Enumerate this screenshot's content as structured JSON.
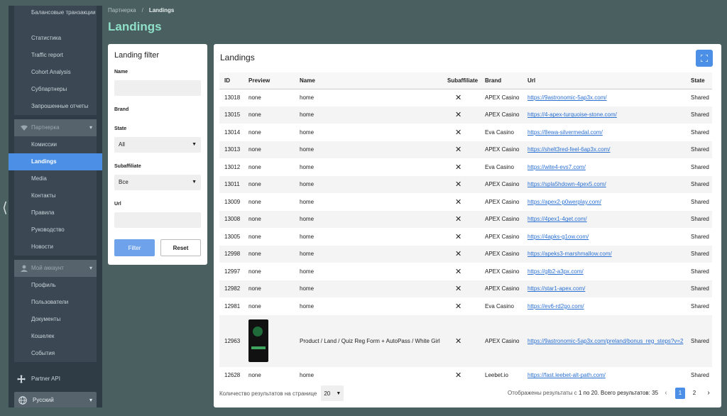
{
  "sidebar": {
    "top_items": [
      {
        "label": "Балансовые транзакции"
      },
      {
        "label": "Статистика"
      },
      {
        "label": "Traffic report"
      },
      {
        "label": "Cohort Analysis"
      },
      {
        "label": "Субпартнеры"
      },
      {
        "label": "Запрошенные отчеты"
      }
    ],
    "partner_header": "Партнерка",
    "partner_items": [
      {
        "label": "Комиссии"
      },
      {
        "label": "Landings"
      },
      {
        "label": "Media"
      },
      {
        "label": "Контакты"
      },
      {
        "label": "Правила"
      },
      {
        "label": "Руководство"
      },
      {
        "label": "Новости"
      }
    ],
    "account_header": "Мой аккаунт",
    "account_items": [
      {
        "label": "Профиль"
      },
      {
        "label": "Пользователи"
      },
      {
        "label": "Документы"
      },
      {
        "label": "Кошелек"
      },
      {
        "label": "События"
      }
    ],
    "api_label": "Partner API",
    "language": "Русский"
  },
  "breadcrumb": {
    "parent": "Партнерка",
    "sep": "/",
    "current": "Landings"
  },
  "page_title": "Landings",
  "filter": {
    "title": "Landing filter",
    "name_label": "Name",
    "name_value": "",
    "brand_label": "Brand",
    "state_label": "State",
    "state_value": "All",
    "subaffiliate_label": "Subaffiliate",
    "subaffiliate_value": "Все",
    "url_label": "Url",
    "url_value": "",
    "filter_button": "Filter",
    "reset_button": "Reset"
  },
  "table": {
    "title": "Landings",
    "columns": [
      "ID",
      "Preview",
      "Name",
      "Subaffiliate",
      "Brand",
      "Url",
      "State"
    ],
    "rows": [
      {
        "id": "13018",
        "preview": "none",
        "name": "home",
        "sub": "✕",
        "brand": "APEX Casino",
        "url": "https://9astronomic-5ap3x.com/",
        "state": "Shared"
      },
      {
        "id": "13015",
        "preview": "none",
        "name": "home",
        "sub": "✕",
        "brand": "APEX Casino",
        "url": "https://4-apex-turquoise-stone.com/",
        "state": "Shared"
      },
      {
        "id": "13014",
        "preview": "none",
        "name": "home",
        "sub": "✕",
        "brand": "Eva Casino",
        "url": "https://8ewa-silvermedal.com/",
        "state": "Shared"
      },
      {
        "id": "13013",
        "preview": "none",
        "name": "home",
        "sub": "✕",
        "brand": "APEX Casino",
        "url": "https://shelt3red-feel-6ap3x.com/",
        "state": "Shared"
      },
      {
        "id": "13012",
        "preview": "none",
        "name": "home",
        "sub": "✕",
        "brand": "Eva Casino",
        "url": "https://wite4-evs7.com/",
        "state": "Shared"
      },
      {
        "id": "13011",
        "preview": "none",
        "name": "home",
        "sub": "✕",
        "brand": "APEX Casino",
        "url": "https://spla5hdown-4pex5.com/",
        "state": "Shared"
      },
      {
        "id": "13009",
        "preview": "none",
        "name": "home",
        "sub": "✕",
        "brand": "APEX Casino",
        "url": "https://apex2-p0werplay.com/",
        "state": "Shared"
      },
      {
        "id": "13008",
        "preview": "none",
        "name": "home",
        "sub": "✕",
        "brand": "APEX Casino",
        "url": "https://4pex1-4get.com/",
        "state": "Shared"
      },
      {
        "id": "13005",
        "preview": "none",
        "name": "home",
        "sub": "✕",
        "brand": "APEX Casino",
        "url": "https://4apks-g1ow.com/",
        "state": "Shared"
      },
      {
        "id": "12998",
        "preview": "none",
        "name": "home",
        "sub": "✕",
        "brand": "APEX Casino",
        "url": "https://apeks3-marshmallow.com/",
        "state": "Shared"
      },
      {
        "id": "12997",
        "preview": "none",
        "name": "home",
        "sub": "✕",
        "brand": "APEX Casino",
        "url": "https://glb2-a3px.com/",
        "state": "Shared"
      },
      {
        "id": "12982",
        "preview": "none",
        "name": "home",
        "sub": "✕",
        "brand": "APEX Casino",
        "url": "https://star1-apex.com/",
        "state": "Shared"
      },
      {
        "id": "12981",
        "preview": "none",
        "name": "home",
        "sub": "✕",
        "brand": "Eva Casino",
        "url": "https://ev6-rd2go.com/",
        "state": "Shared"
      },
      {
        "id": "12963",
        "preview": "",
        "name": "Product / Land / Quiz Reg Form + AutoPass / White Girl",
        "sub": "✕",
        "brand": "APEX Casino",
        "url": "https://9astronomic-5ap3x.com/preland/bonus_reg_steps?v=2",
        "state": "Shared"
      },
      {
        "id": "12628",
        "preview": "none",
        "name": "home",
        "sub": "✕",
        "brand": "Leebet.io",
        "url": "https://fast.leebet-alt-path.com/",
        "state": "Shared"
      }
    ]
  },
  "footer": {
    "per_page_label": "Количество результатов на странице",
    "per_page_value": "20",
    "results_prefix": "Отображены результаты с",
    "results_range": "1 по 20",
    "results_total_label": ". Всего результатов:",
    "results_total": "35",
    "pages": [
      "1",
      "2"
    ],
    "prev": "‹",
    "next": "›"
  },
  "colors": {
    "accent": "#4b8fe6",
    "title": "#8fe0c8",
    "background": "#4a5f60",
    "sidebar": "#2f3b45"
  }
}
